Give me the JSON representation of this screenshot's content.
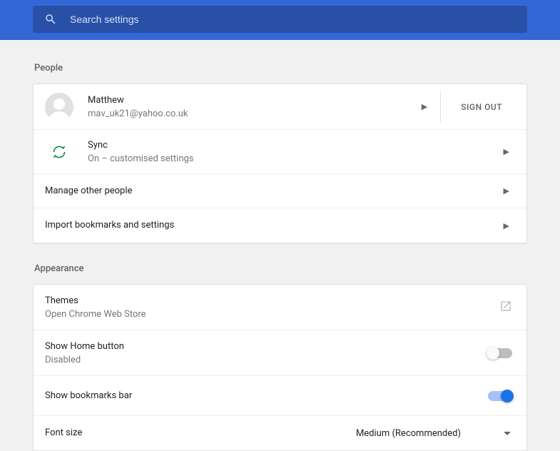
{
  "search": {
    "placeholder": "Search settings"
  },
  "sections": {
    "people": {
      "title": "People",
      "account": {
        "name": "Matthew",
        "email": "mav_uk21@yahoo.co.uk",
        "signout": "SIGN OUT"
      },
      "sync": {
        "title": "Sync",
        "status": "On – customised settings"
      },
      "manage": "Manage other people",
      "import": "Import bookmarks and settings"
    },
    "appearance": {
      "title": "Appearance",
      "themes": {
        "title": "Themes",
        "sub": "Open Chrome Web Store"
      },
      "home": {
        "title": "Show Home button",
        "sub": "Disabled",
        "on": false
      },
      "bookmarks": {
        "title": "Show bookmarks bar",
        "on": true
      },
      "fontsize": {
        "title": "Font size",
        "value": "Medium (Recommended)"
      }
    }
  }
}
